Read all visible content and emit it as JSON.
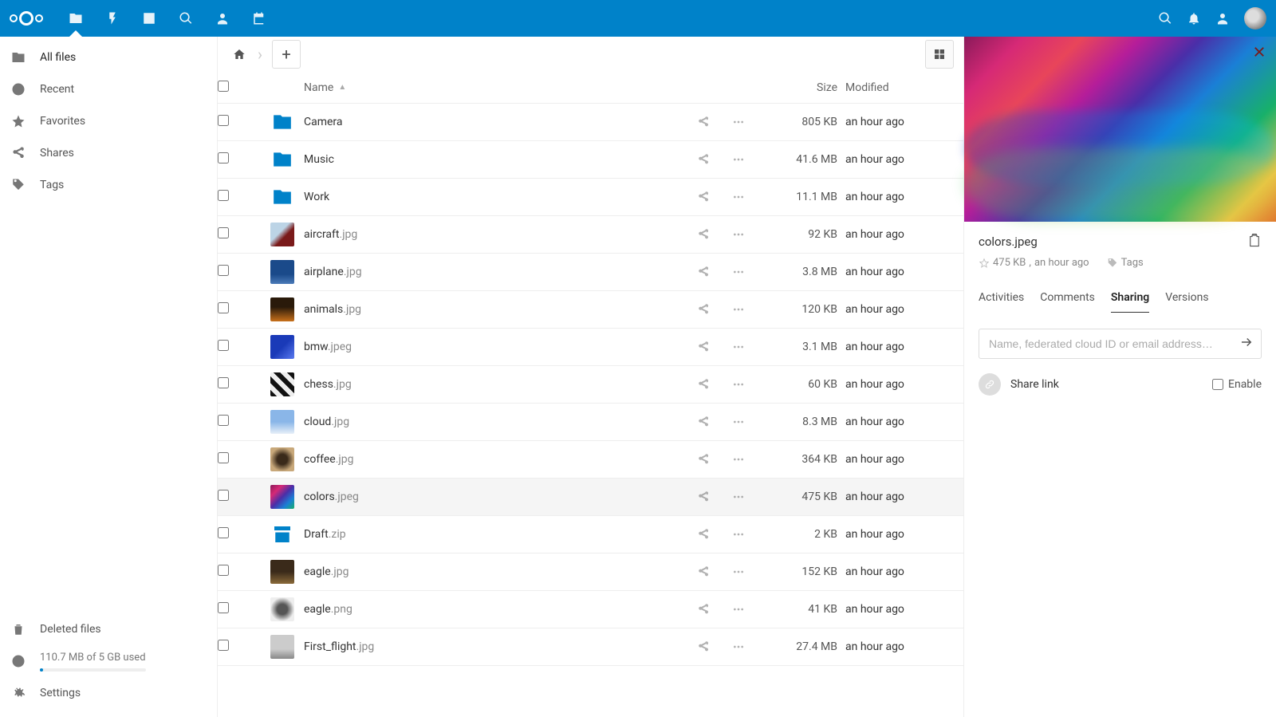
{
  "topbar": {
    "apps": [
      "files",
      "activity",
      "gallery",
      "search",
      "contacts",
      "calendar"
    ],
    "active_app": "files"
  },
  "left_nav": {
    "items": [
      {
        "id": "all-files",
        "label": "All files",
        "active": true
      },
      {
        "id": "recent",
        "label": "Recent",
        "active": false
      },
      {
        "id": "favorites",
        "label": "Favorites",
        "active": false
      },
      {
        "id": "shares",
        "label": "Shares",
        "active": false
      },
      {
        "id": "tags",
        "label": "Tags",
        "active": false
      }
    ],
    "deleted_label": "Deleted files",
    "storage_text": "110.7 MB of 5 GB used",
    "settings_label": "Settings"
  },
  "file_list": {
    "headers": {
      "name": "Name",
      "size": "Size",
      "modified": "Modified"
    },
    "sort_col": "name",
    "sort_dir": "asc",
    "rows": [
      {
        "name": "Camera",
        "ext": "",
        "type": "folder",
        "size": "805 KB",
        "modified": "an hour ago",
        "thumb": ""
      },
      {
        "name": "Music",
        "ext": "",
        "type": "folder",
        "size": "41.6 MB",
        "modified": "an hour ago",
        "thumb": ""
      },
      {
        "name": "Work",
        "ext": "",
        "type": "folder",
        "size": "11.1 MB",
        "modified": "an hour ago",
        "thumb": ""
      },
      {
        "name": "aircraft",
        "ext": ".jpg",
        "type": "image",
        "size": "92 KB",
        "modified": "an hour ago",
        "thumb": "linear-gradient(135deg,#bcd4e6 40%,#7a1a1a 60%)"
      },
      {
        "name": "airplane",
        "ext": ".jpg",
        "type": "image",
        "size": "3.8 MB",
        "modified": "an hour ago",
        "thumb": "linear-gradient(180deg,#1a4a8a 60%,#4a7ab8 100%)"
      },
      {
        "name": "animals",
        "ext": ".jpg",
        "type": "image",
        "size": "120 KB",
        "modified": "an hour ago",
        "thumb": "linear-gradient(180deg,#2a1a0a 40%,#c8701a 100%)"
      },
      {
        "name": "bmw",
        "ext": ".jpeg",
        "type": "image",
        "size": "3.1 MB",
        "modified": "an hour ago",
        "thumb": "linear-gradient(135deg,#1a3ab8 50%,#5a7af0 100%)"
      },
      {
        "name": "chess",
        "ext": ".jpg",
        "type": "image",
        "size": "60 KB",
        "modified": "an hour ago",
        "thumb": "repeating-linear-gradient(45deg,#111 0 6px,#eee 6px 12px)"
      },
      {
        "name": "cloud",
        "ext": ".jpg",
        "type": "image",
        "size": "8.3 MB",
        "modified": "an hour ago",
        "thumb": "linear-gradient(180deg,#8ab6e8 50%,#e8f0f8 100%)"
      },
      {
        "name": "coffee",
        "ext": ".jpg",
        "type": "image",
        "size": "364 KB",
        "modified": "an hour ago",
        "thumb": "radial-gradient(circle,#3a2a1a 30%,#c8a87a 70%)"
      },
      {
        "name": "colors",
        "ext": ".jpeg",
        "type": "image",
        "size": "475 KB",
        "modified": "an hour ago",
        "thumb": "linear-gradient(135deg,#8a1a5a,#d62976,#4a2ea8,#1a7fd6,#18b06a)",
        "selected": true
      },
      {
        "name": "Draft",
        "ext": ".zip",
        "type": "archive",
        "size": "2 KB",
        "modified": "an hour ago",
        "thumb": ""
      },
      {
        "name": "eagle",
        "ext": ".jpg",
        "type": "image",
        "size": "152 KB",
        "modified": "an hour ago",
        "thumb": "linear-gradient(180deg,#3a2a1a 50%,#8a6a3a 100%)"
      },
      {
        "name": "eagle",
        "ext": ".png",
        "type": "image",
        "size": "41 KB",
        "modified": "an hour ago",
        "thumb": "radial-gradient(circle,#555 30%,#eee 70%)"
      },
      {
        "name": "First_flight",
        "ext": ".jpg",
        "type": "image",
        "size": "27.4 MB",
        "modified": "an hour ago",
        "thumb": "linear-gradient(180deg,#ccc 60%,#888 100%)"
      }
    ]
  },
  "details": {
    "filename": "colors.jpeg",
    "size": "475 KB",
    "modified": "an hour ago",
    "tags_label": "Tags",
    "tabs": [
      {
        "id": "activities",
        "label": "Activities",
        "active": false
      },
      {
        "id": "comments",
        "label": "Comments",
        "active": false
      },
      {
        "id": "sharing",
        "label": "Sharing",
        "active": true
      },
      {
        "id": "versions",
        "label": "Versions",
        "active": false
      }
    ],
    "share_placeholder": "Name, federated cloud ID or email address…",
    "share_link_label": "Share link",
    "enable_label": "Enable"
  }
}
